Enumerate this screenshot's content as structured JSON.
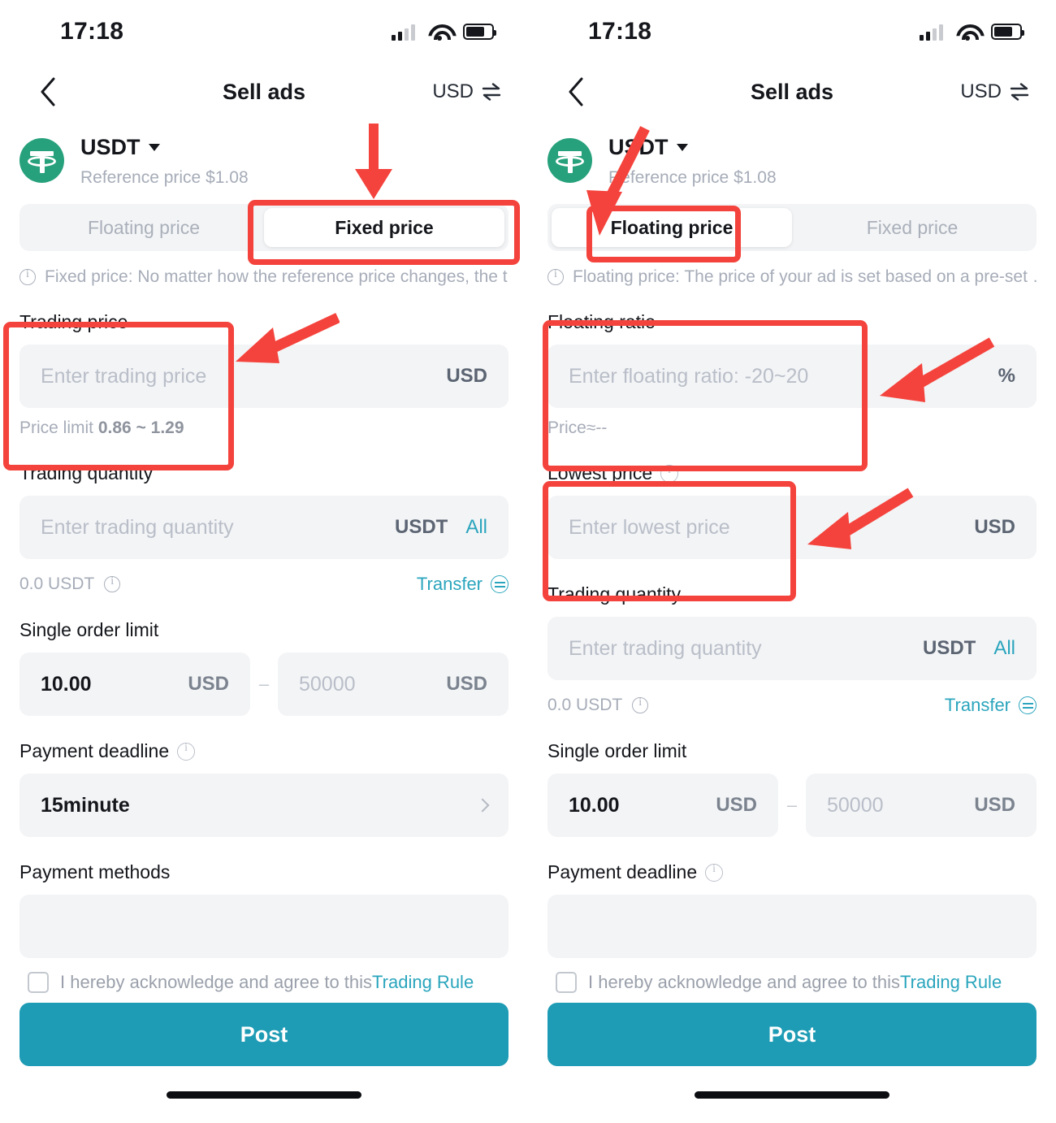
{
  "status_bar": {
    "time": "17:18",
    "signal_icon": "signal-bars-icon",
    "wifi_icon": "wifi-icon",
    "battery_icon": "battery-icon"
  },
  "nav": {
    "back_icon": "chevron-left-icon",
    "title": "Sell ads",
    "currency": "USD",
    "swap_icon": "swap-vertical-icon"
  },
  "coin": {
    "symbol": "USDT",
    "dropdown_icon": "caret-down-icon",
    "reference_price": "Reference price $1.08",
    "icon": "usdt-tether-icon",
    "brand_color": "#26a17b"
  },
  "segmented": {
    "floating_label": "Floating price",
    "fixed_label": "Fixed price"
  },
  "hints": {
    "fixed": "Fixed price: No matter how the reference price changes, the tradi…",
    "floating": "Floating price: The price of your ad is set based on a pre-set …"
  },
  "left": {
    "active_tab": "Fixed price",
    "trading_price": {
      "label": "Trading price",
      "placeholder": "Enter trading price",
      "unit": "USD",
      "note_prefix": "Price limit ",
      "note_value": "0.86 ~ 1.29"
    },
    "trading_quantity": {
      "label": "Trading quantity",
      "placeholder": "Enter trading quantity",
      "unit": "USDT",
      "all_label": "All"
    },
    "balance": {
      "text": "0.0 USDT",
      "info_icon": "info-circle-icon"
    },
    "transfer": {
      "label": "Transfer",
      "icon": "transfer-arrows-icon"
    },
    "single_order_limit": {
      "label": "Single order limit",
      "min_value": "10.00",
      "min_unit": "USD",
      "separator": "–",
      "max_placeholder": "50000",
      "max_unit": "USD"
    },
    "payment_deadline": {
      "label": "Payment deadline",
      "info_icon": "info-circle-icon",
      "value": "15minute",
      "chevron_icon": "chevron-right-icon"
    },
    "payment_methods": {
      "label": "Payment methods"
    }
  },
  "right": {
    "active_tab": "Floating price",
    "floating_ratio": {
      "label": "Floating ratio",
      "placeholder": "Enter floating ratio: -20~20",
      "unit": "%",
      "note": "Price≈--"
    },
    "lowest_price": {
      "label": "Lowest price",
      "info_icon": "info-circle-icon",
      "placeholder": "Enter lowest price",
      "unit": "USD"
    },
    "trading_quantity": {
      "label": "Trading quantity",
      "placeholder": "Enter trading quantity",
      "unit": "USDT",
      "all_label": "All"
    },
    "balance": {
      "text": "0.0 USDT",
      "info_icon": "info-circle-icon"
    },
    "transfer": {
      "label": "Transfer",
      "icon": "transfer-arrows-icon"
    },
    "single_order_limit": {
      "label": "Single order limit",
      "min_value": "10.00",
      "min_unit": "USD",
      "separator": "–",
      "max_placeholder": "50000",
      "max_unit": "USD"
    },
    "payment_deadline": {
      "label": "Payment deadline",
      "info_icon": "info-circle-icon"
    }
  },
  "footer": {
    "agree_text": "I hereby acknowledge and agree to this",
    "rule_link": "Trading Rule",
    "post_label": "Post",
    "post_color": "#1f9cb5"
  },
  "annotations": {
    "highlight_color": "#f4433c"
  }
}
